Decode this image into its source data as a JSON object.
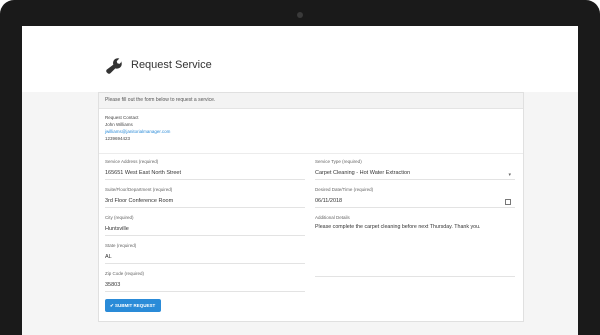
{
  "page": {
    "title": "Request Service"
  },
  "form": {
    "intro": "Please fill out the form below to request a service.",
    "request_contact": {
      "label": "Request Contact",
      "name": "John Williams",
      "email": "jwilliams@janitorialmanager.com",
      "phone": "1239694423"
    },
    "fields": {
      "service_address": {
        "label": "Service Address (required)",
        "value": "165651 West East North Street"
      },
      "suite": {
        "label": "Suite/Floor/Department (required)",
        "value": "3rd Floor Conference Room"
      },
      "city": {
        "label": "City (required)",
        "value": "Huntsville"
      },
      "state": {
        "label": "State (required)",
        "value": "AL"
      },
      "zip": {
        "label": "Zip Code (required)",
        "value": "35803"
      },
      "service_type": {
        "label": "Service Type (required)",
        "value": "Carpet Cleaning - Hot Water Extraction"
      },
      "desired_date": {
        "label": "Desired Date/Time (required)",
        "value": "06/11/2018"
      },
      "details": {
        "label": "Additional Details",
        "value": "Please complete the carpet cleaning before next Thursday. Thank you."
      }
    },
    "submit_label": "✔ SUBMIT REQUEST"
  },
  "colors": {
    "accent": "#2a8bd8",
    "bezel": "#1a1a1a"
  },
  "icons": {
    "title_icon": "wrench-icon",
    "select_icon": "caret-down-icon",
    "date_icon": "calendar-icon"
  }
}
